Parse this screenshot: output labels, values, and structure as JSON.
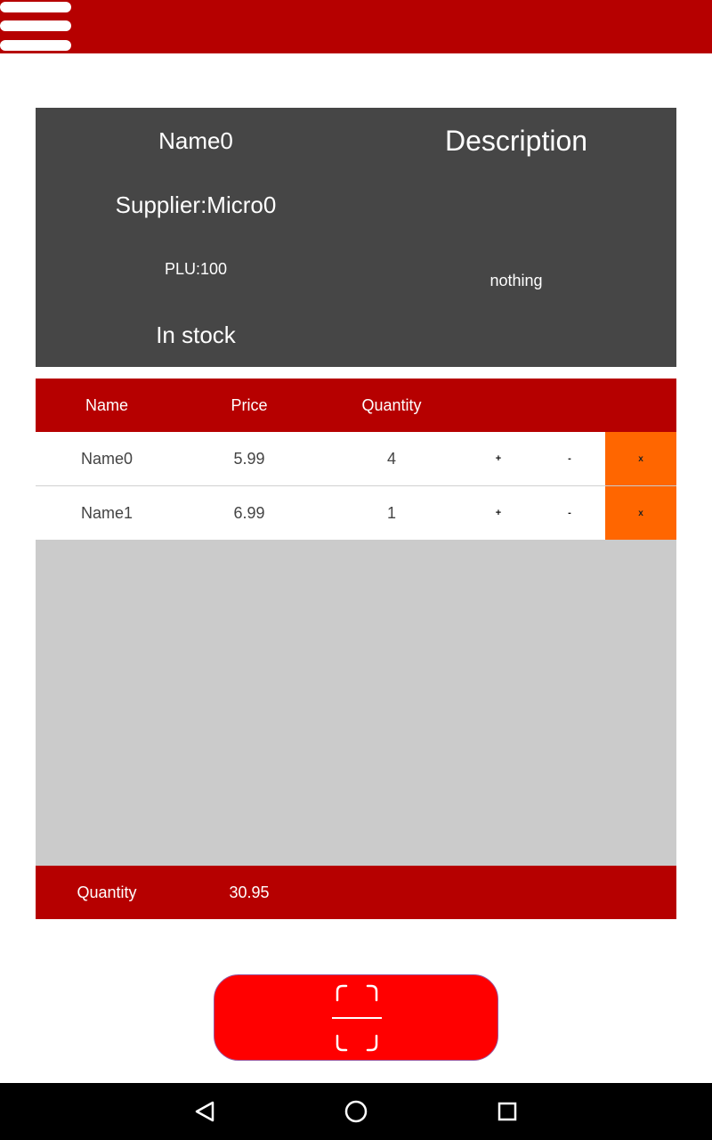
{
  "app_bar": {
    "menu_icon": "hamburger-menu-icon",
    "color": "#b60000"
  },
  "product": {
    "name": "Name0",
    "supplier": "Supplier:Micro0",
    "plu": "PLU:100",
    "stock_status": "In stock",
    "description_title": "Description",
    "description": "nothing"
  },
  "table": {
    "columns": [
      "Name",
      "Price",
      "Quantity"
    ],
    "rows": [
      {
        "name": "Name0",
        "price": "5.99",
        "quantity": "4",
        "plus": "+",
        "minus": "-",
        "remove": "x"
      },
      {
        "name": "Name1",
        "price": "6.99",
        "quantity": "1",
        "plus": "+",
        "minus": "-",
        "remove": "x"
      }
    ]
  },
  "footer": {
    "label": "Quantity",
    "value": "30.95"
  },
  "scan_button": {
    "icon": "barcode-scan-icon"
  },
  "nav": {
    "back_icon": "back-triangle-icon",
    "home_icon": "home-circle-icon",
    "recents_icon": "recents-square-icon"
  },
  "colors": {
    "primary": "#b60000",
    "card": "#464646",
    "remove": "#ff6600",
    "scan": "#ff0000",
    "list_bg": "#cbcbcb"
  }
}
